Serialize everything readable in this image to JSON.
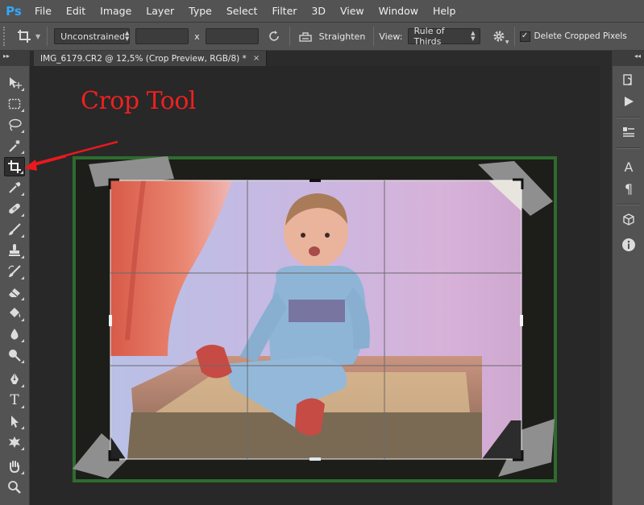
{
  "app": {
    "logo": "Ps",
    "menu": [
      "File",
      "Edit",
      "Image",
      "Layer",
      "Type",
      "Select",
      "Filter",
      "3D",
      "View",
      "Window",
      "Help"
    ]
  },
  "options": {
    "ratio_preset": "Unconstrained",
    "ratio_separator": "x",
    "width_value": "",
    "height_value": "",
    "straighten_label": "Straighten",
    "view_label": "View:",
    "view_overlay": "Rule of Thirds",
    "delete_cropped_label": "Delete Cropped Pixels",
    "delete_cropped_checked": true
  },
  "document": {
    "tab_title": "IMG_6179.CR2 @ 12,5% (Crop Preview, RGB/8) *",
    "tab_close": "×"
  },
  "annotation": {
    "title": "Crop Tool",
    "color": "#ef2020"
  },
  "tools": [
    {
      "name": "move-tool",
      "icon": "move-icon"
    },
    {
      "name": "marquee-tool",
      "icon": "rect-marquee-icon"
    },
    {
      "name": "lasso-tool",
      "icon": "lasso-icon"
    },
    {
      "name": "magic-wand-tool",
      "icon": "magic-wand-icon"
    },
    {
      "name": "crop-tool",
      "icon": "crop-icon",
      "active": true
    },
    {
      "name": "eyedropper-tool",
      "icon": "eyedropper-icon"
    },
    {
      "name": "healing-brush-tool",
      "icon": "bandage-icon"
    },
    {
      "name": "brush-tool",
      "icon": "brush-icon"
    },
    {
      "name": "clone-stamp-tool",
      "icon": "stamp-icon"
    },
    {
      "name": "history-brush-tool",
      "icon": "history-brush-icon"
    },
    {
      "name": "eraser-tool",
      "icon": "eraser-icon"
    },
    {
      "name": "paint-bucket-tool",
      "icon": "bucket-icon"
    },
    {
      "name": "blur-tool",
      "icon": "drop-icon"
    },
    {
      "name": "dodge-tool",
      "icon": "dodge-icon"
    },
    {
      "name": "pen-tool",
      "icon": "pen-icon"
    },
    {
      "name": "type-tool",
      "icon": "type-icon",
      "glyph": "T"
    },
    {
      "name": "path-selection-tool",
      "icon": "arrow-select-icon"
    },
    {
      "name": "shape-tool",
      "icon": "custom-shape-icon"
    },
    {
      "name": "hand-tool",
      "icon": "hand-icon"
    },
    {
      "name": "zoom-tool",
      "icon": "zoom-icon"
    }
  ],
  "right_panels": [
    {
      "name": "history-panel-button",
      "icon": "history-icon"
    },
    {
      "name": "actions-panel-button",
      "icon": "play-icon"
    },
    {
      "name": "layer-comps-panel-button",
      "icon": "layer-comps-icon"
    },
    {
      "name": "character-panel-button",
      "icon": "character-icon",
      "glyph": "A"
    },
    {
      "name": "paragraph-panel-button",
      "icon": "paragraph-icon",
      "glyph": "¶"
    },
    {
      "name": "3d-panel-button",
      "icon": "3d-cube-icon"
    },
    {
      "name": "info-panel-button",
      "icon": "info-icon"
    }
  ],
  "colors": {
    "chrome": "#535353",
    "workspace": "#282828",
    "accent_arrow": "#e8191f",
    "photo_frame_green": "#2f6b2f"
  }
}
